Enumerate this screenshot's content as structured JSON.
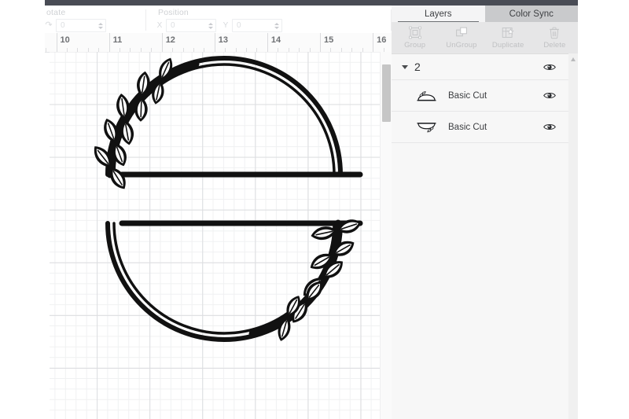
{
  "toolbar": {
    "rotate": {
      "label": "otate",
      "icon": "rotate-icon",
      "value": "0",
      "placeholder": "0"
    },
    "position": {
      "label": "Position",
      "x_letter": "X",
      "x_value": "0",
      "y_letter": "Y",
      "y_value": "0"
    }
  },
  "ruler": {
    "unit": "inch",
    "marks": [
      "10",
      "11",
      "12",
      "13",
      "14",
      "15",
      "16"
    ]
  },
  "canvas": {
    "artwork_name": "split-laurel-wreath-monogram",
    "stroke_color": "#111111",
    "grid_major_color": "#dcdde0",
    "grid_minor_color": "#f0f1f2"
  },
  "right_panel": {
    "tabs": [
      {
        "label": "Layers",
        "active": true
      },
      {
        "label": "Color Sync",
        "active": false
      }
    ],
    "actions": [
      {
        "label": "Group",
        "icon": "group-icon",
        "disabled": true
      },
      {
        "label": "UnGroup",
        "icon": "ungroup-icon",
        "disabled": true
      },
      {
        "label": "Duplicate",
        "icon": "duplicate-icon",
        "disabled": true
      },
      {
        "label": "Delete",
        "icon": "trash-icon",
        "disabled": true
      }
    ],
    "layers": {
      "group": {
        "name": "2",
        "expanded": true,
        "visible": true,
        "caret_icon": "chevron-down-icon",
        "eye_icon": "eye-icon"
      },
      "children": [
        {
          "name": "Basic Cut",
          "thumbnail": "top-arc-thumb",
          "visible": true,
          "eye_icon": "eye-icon"
        },
        {
          "name": "Basic Cut",
          "thumbnail": "bottom-arc-thumb",
          "visible": true,
          "eye_icon": "eye-icon"
        }
      ]
    }
  },
  "colors": {
    "topbar": "#494c55",
    "tab_bar": "#c9cacc",
    "action_bar": "#e6e6e7",
    "panel_bg": "#f7f7f7",
    "scroll_thumb": "#c6c6c6"
  }
}
